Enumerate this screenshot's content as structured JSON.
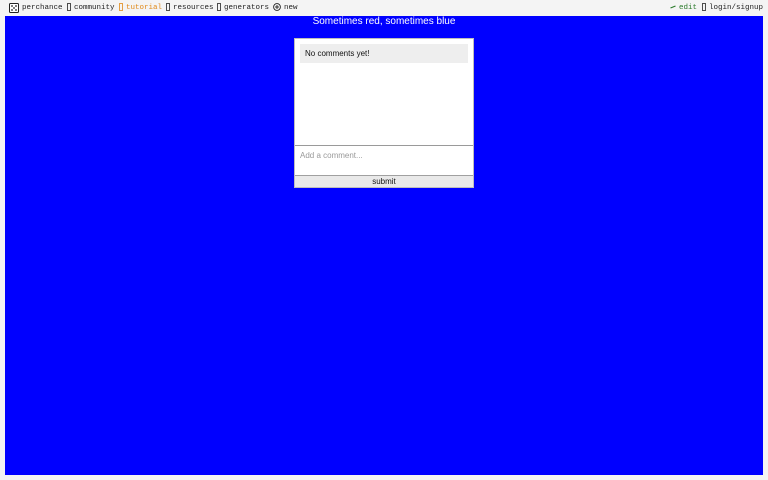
{
  "nav": {
    "brand": "perchance",
    "community": "community",
    "tutorial": "tutorial",
    "resources": "resources",
    "generators": "generators",
    "new": "new",
    "edit": "edit",
    "login": "login/signup",
    "icons": {
      "brand": "dice-icon",
      "community": "community-icon",
      "tutorial": "tutorial-icon",
      "resources": "resources-icon",
      "generators": "generators-icon",
      "new": "plus-circle-icon",
      "edit": "pencil-icon",
      "login": "user-icon"
    }
  },
  "page": {
    "title": "Sometimes red, sometimes blue",
    "background_color": "#0000ff"
  },
  "comments": {
    "empty_text": "No comments yet!",
    "input_placeholder": "Add a comment...",
    "submit_label": "submit"
  }
}
